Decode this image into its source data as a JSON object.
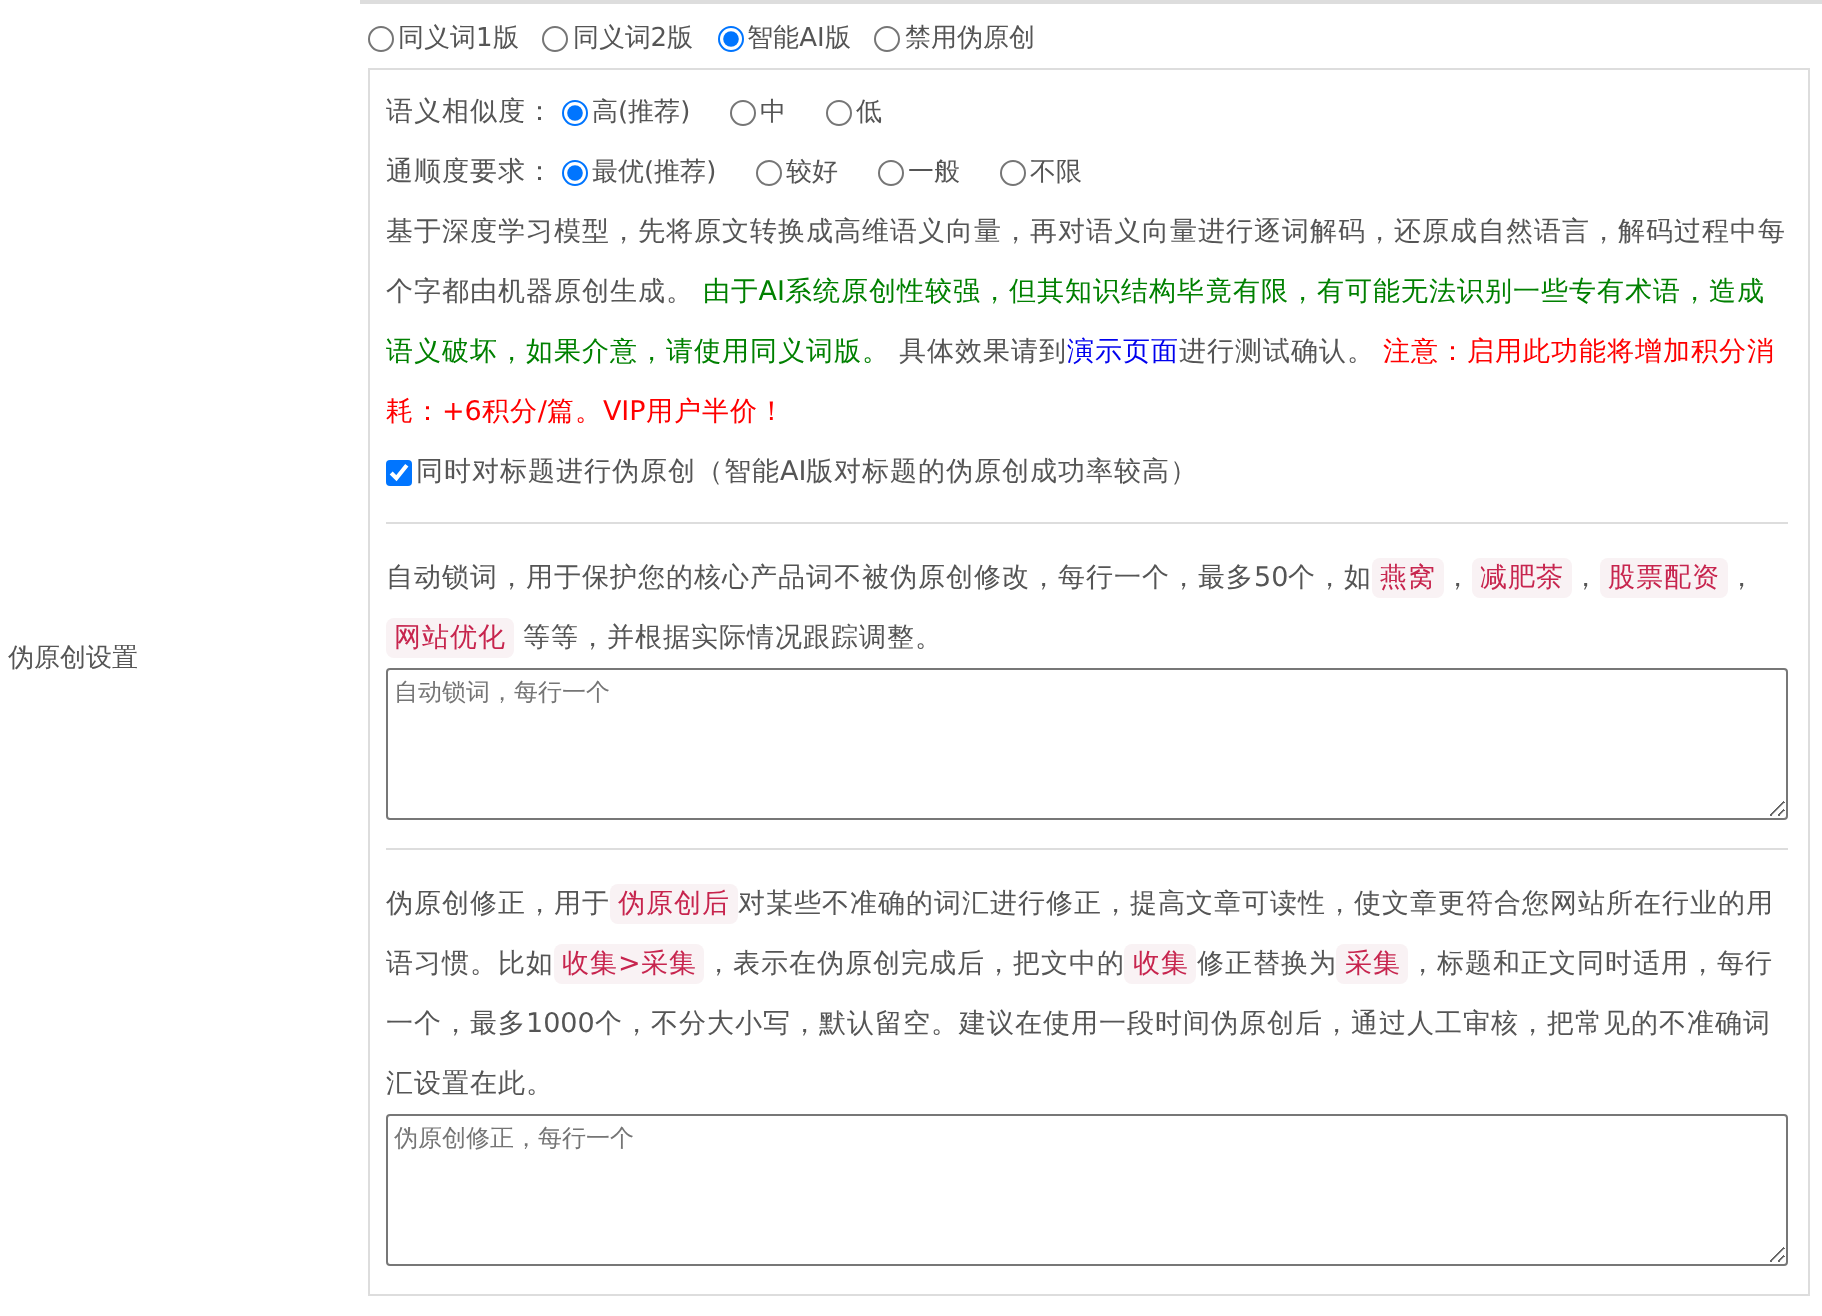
{
  "section_label": "伪原创设置",
  "modes": [
    {
      "label": "同义词1版",
      "selected": false
    },
    {
      "label": "同义词2版",
      "selected": false
    },
    {
      "label": "智能AI版",
      "selected": true
    },
    {
      "label": "禁用伪原创",
      "selected": false
    }
  ],
  "settings": [
    {
      "label": "语义相似度：",
      "options": [
        {
          "label": "高(推荐)",
          "selected": true
        },
        {
          "label": "中",
          "selected": false
        },
        {
          "label": "低",
          "selected": false
        }
      ]
    },
    {
      "label": "通顺度要求：",
      "options": [
        {
          "label": "最优(推荐)",
          "selected": true
        },
        {
          "label": "较好",
          "selected": false
        },
        {
          "label": "一般",
          "selected": false
        },
        {
          "label": "不限",
          "selected": false
        }
      ]
    }
  ],
  "description": [
    {
      "kind": "plain",
      "text": "基于深度学习模型，先将原文转换成高维语义向量，再对语义向量进行逐词解码，还原成自然语言，解码过程中每个字都由机器原创生成。 "
    },
    {
      "kind": "notice",
      "text": "由于AI系统原创性较强，但其知识结构毕竟有限，有可能无法识别一些专有术语，造成语义破坏，如果介意，请使用同义词版。"
    },
    {
      "kind": "plain",
      "text": " 具体效果请到"
    },
    {
      "kind": "link",
      "text": "演示页面"
    },
    {
      "kind": "plain",
      "text": "进行测试确认。 "
    },
    {
      "kind": "warning",
      "text": "注意：启用此功能将增加积分消耗：+6积分/篇。VIP用户半价！"
    }
  ],
  "title_option": {
    "label": "同时对标题进行伪原创（智能AI版对标题的伪原创成功率较高）",
    "checked": true
  },
  "lock_words": {
    "description": [
      {
        "kind": "plain",
        "text": "自动锁词，用于保护您的核心产品词不被伪原创修改，每行一个，最多50个，如"
      },
      {
        "kind": "code",
        "text": "燕窝"
      },
      {
        "kind": "plain",
        "text": "，"
      },
      {
        "kind": "code",
        "text": "减肥茶"
      },
      {
        "kind": "plain",
        "text": "，"
      },
      {
        "kind": "code",
        "text": "股票配资"
      },
      {
        "kind": "plain",
        "text": "，"
      },
      {
        "kind": "code",
        "text": "网站优化"
      },
      {
        "kind": "plain",
        "text": " 等等，并根据实际情况跟踪调整。"
      }
    ],
    "placeholder": "自动锁词，每行一个"
  },
  "corrections": {
    "description": [
      {
        "kind": "plain",
        "text": "伪原创修正，用于"
      },
      {
        "kind": "code",
        "text": "伪原创后"
      },
      {
        "kind": "plain",
        "text": "对某些不准确的词汇进行修正，提高文章可读性，使文章更符合您网站所在行业的用语习惯。比如"
      },
      {
        "kind": "code",
        "text": "收集>采集"
      },
      {
        "kind": "plain",
        "text": "，表示在伪原创完成后，把文中的"
      },
      {
        "kind": "code",
        "text": "收集"
      },
      {
        "kind": "plain",
        "text": "修正替换为"
      },
      {
        "kind": "code",
        "text": "采集"
      },
      {
        "kind": "plain",
        "text": "，标题和正文同时适用，每行一个，最多1000个，不分大小写，默认留空。建议在使用一段时间伪原创后，通过人工审核，把常见的不准确词汇设置在此。"
      }
    ],
    "placeholder": "伪原创修正，每行一个"
  }
}
